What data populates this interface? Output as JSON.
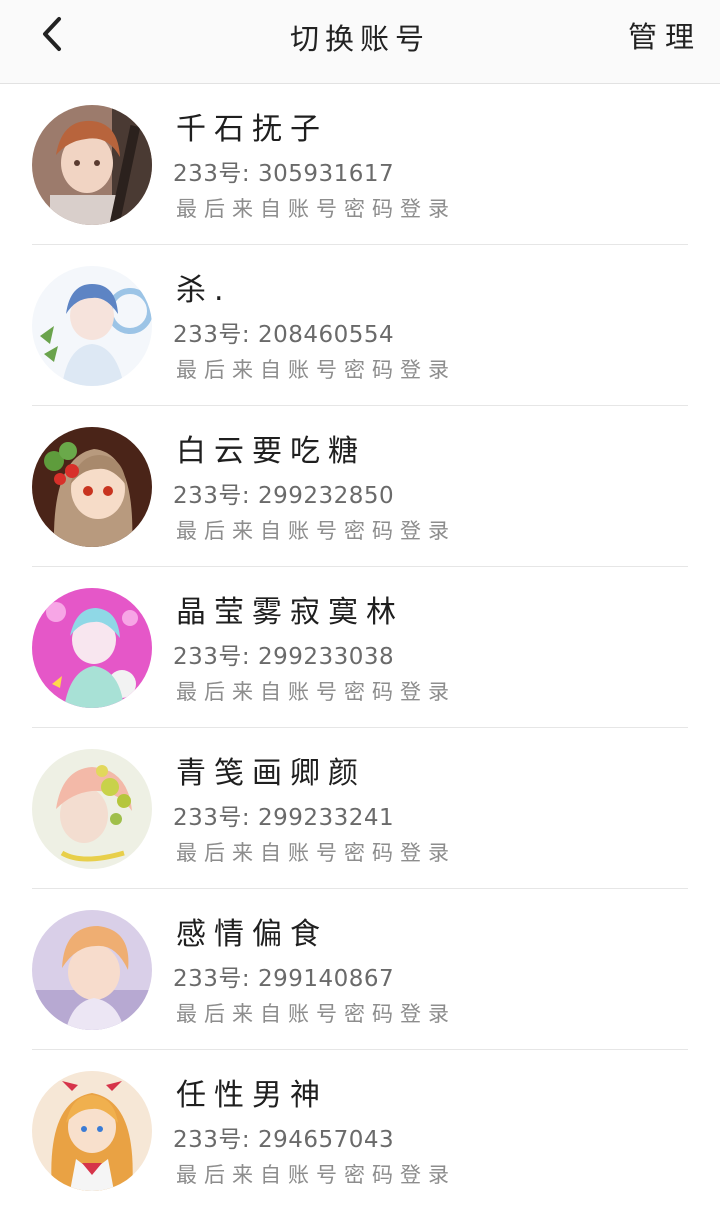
{
  "header": {
    "title": "切换账号",
    "manage_label": "管理"
  },
  "accounts": [
    {
      "name": "千石抚子",
      "uid": "233号: 305931617",
      "login_note": "最后来自账号密码登录",
      "avatar": "anime-avatar-boy-guitar-icon"
    },
    {
      "name": "杀.",
      "uid": "233号: 208460554",
      "login_note": "最后来自账号密码登录",
      "avatar": "anime-avatar-blue-hair-girl-icon"
    },
    {
      "name": "白云要吃糖",
      "uid": "233号: 299232850",
      "login_note": "最后来自账号密码登录",
      "avatar": "anime-avatar-strawberry-girl-icon"
    },
    {
      "name": "晶莹雾寂寞林",
      "uid": "233号: 299233038",
      "login_note": "最后来自账号密码登录",
      "avatar": "anime-avatar-pink-bubble-icon"
    },
    {
      "name": "青笺画卿颜",
      "uid": "233号: 299233241",
      "login_note": "最后来自账号密码登录",
      "avatar": "anime-avatar-flowers-girl-icon"
    },
    {
      "name": "感情偏食",
      "uid": "233号: 299140867",
      "login_note": "最后来自账号密码登录",
      "avatar": "anime-avatar-orange-hair-icon"
    },
    {
      "name": "任性男神",
      "uid": "233号: 294657043",
      "login_note": "最后来自账号密码登录",
      "avatar": "anime-avatar-sailor-girl-icon"
    }
  ],
  "colors": {
    "header_bg": "#fafafa",
    "divider": "#e6e6e6",
    "name_text": "#1f1f1f",
    "uid_text": "#6a6a6a",
    "note_text": "#8d8d8d"
  }
}
